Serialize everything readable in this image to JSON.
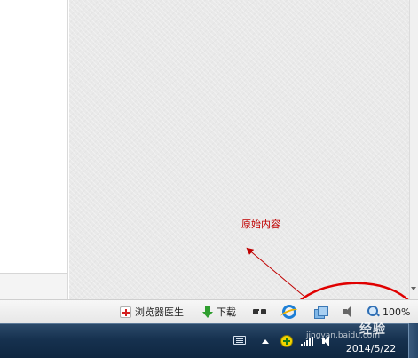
{
  "status_bar": {
    "browser_doctor": {
      "label": "浏览器医生",
      "icon": "browser-doctor-icon"
    },
    "download": {
      "label": "下载",
      "icon": "download-arrow-icon"
    },
    "incognito": {
      "icon": "glasses-icon"
    },
    "ie_core": {
      "icon": "ie-logo-icon"
    },
    "compat_view": {
      "icon": "compatibility-view-icon"
    },
    "mute": {
      "icon": "speaker-icon"
    },
    "zoom": {
      "label": "100%",
      "icon": "magnifier-icon"
    }
  },
  "annotation": {
    "text": "原始内容",
    "color": "#c00000"
  },
  "taskbar": {
    "tray_icons": [
      "keyboard-icon",
      "tray-expand-icon",
      "360-guard-icon",
      "network-signal-icon",
      "volume-icon"
    ],
    "clock_time": "",
    "clock_date": "2014/5/22"
  },
  "watermark": {
    "main": "经验",
    "url": "jingyan.baidu.com"
  }
}
